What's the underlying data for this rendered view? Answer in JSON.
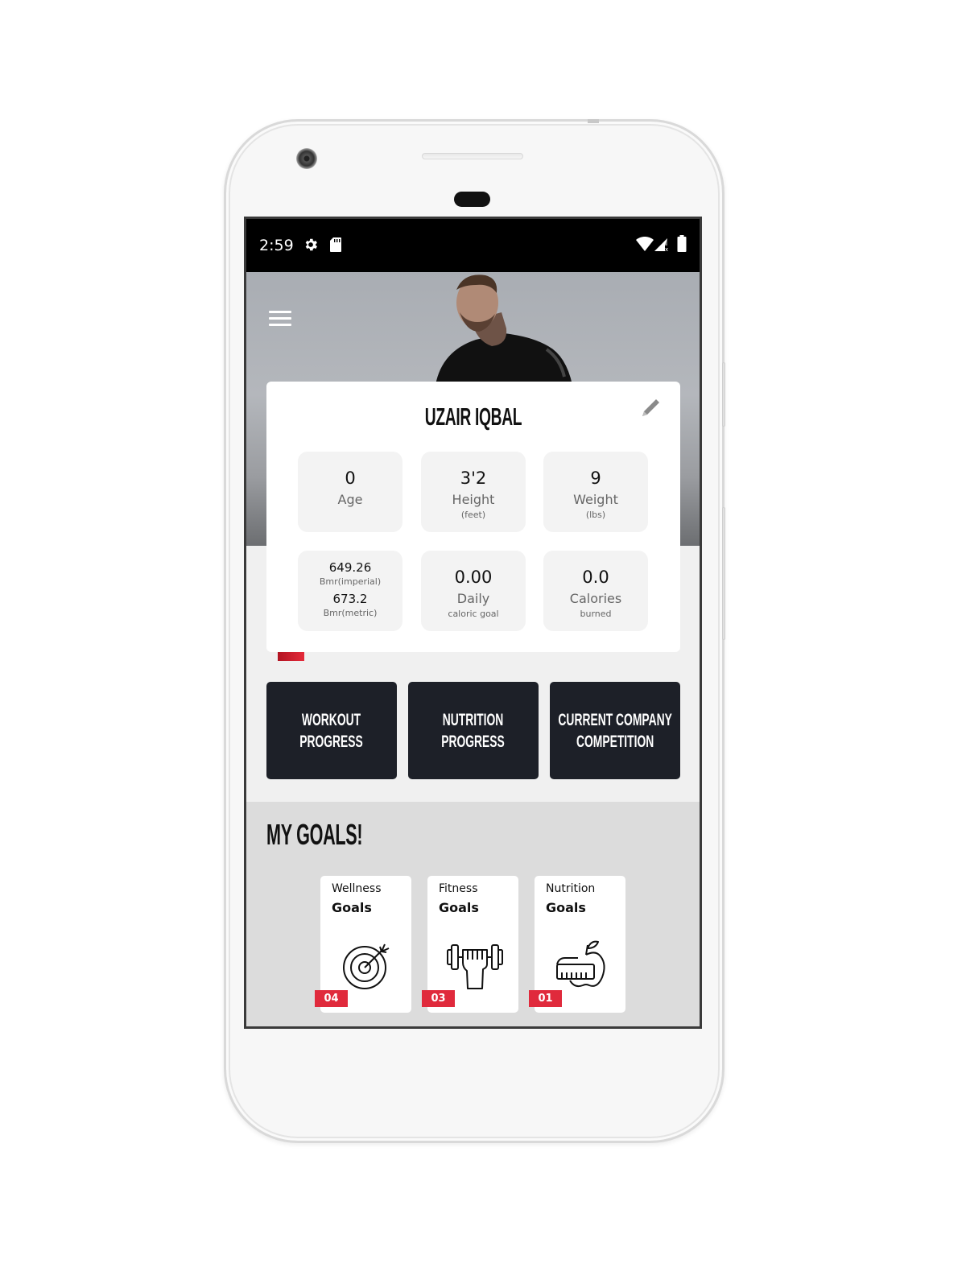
{
  "status_bar": {
    "time": "2:59",
    "left_icons": [
      "gear-icon",
      "sd-card-icon"
    ],
    "right_icons": [
      "wifi-icon",
      "signal-icon",
      "battery-icon"
    ]
  },
  "header": {
    "menu_icon": "hamburger-menu-icon"
  },
  "profile": {
    "name": "UZAIR IQBAL",
    "edit_icon": "pencil-icon",
    "stats": {
      "age": {
        "value": "0",
        "label": "Age"
      },
      "height": {
        "value": "3'2",
        "label": "Height",
        "unit": "(feet)"
      },
      "weight": {
        "value": "9",
        "label": "Weight",
        "unit": "(lbs)"
      },
      "bmr": {
        "imperial_value": "649.26",
        "imperial_label": "Bmr(imperial)",
        "metric_value": "673.2",
        "metric_label": "Bmr(metric)"
      },
      "daily": {
        "value": "0.00",
        "label": "Daily",
        "sub": "caloric goal"
      },
      "calories": {
        "value": "0.0",
        "label": "Calories",
        "sub": "burned"
      }
    }
  },
  "actions": [
    {
      "line1": "WORKOUT",
      "line2": "PROGRESS"
    },
    {
      "line1": "NUTRITION",
      "line2": "PROGRESS"
    },
    {
      "line1": "CURRENT COMPANY",
      "line2": "COMPETITION"
    }
  ],
  "goals": {
    "title": "MY GOALS!",
    "items": [
      {
        "line1": "Wellness",
        "line2": "Goals",
        "icon": "target-icon",
        "count": "04"
      },
      {
        "line1": "Fitness",
        "line2": "Goals",
        "icon": "dumbbell-icon",
        "count": "03"
      },
      {
        "line1": "Nutrition",
        "line2": "Goals",
        "icon": "apple-measure-icon",
        "count": "01"
      }
    ]
  },
  "colors": {
    "accent_red": "#e02a3c",
    "button_dark": "#1d2028",
    "card_bg": "#f3f3f3"
  }
}
